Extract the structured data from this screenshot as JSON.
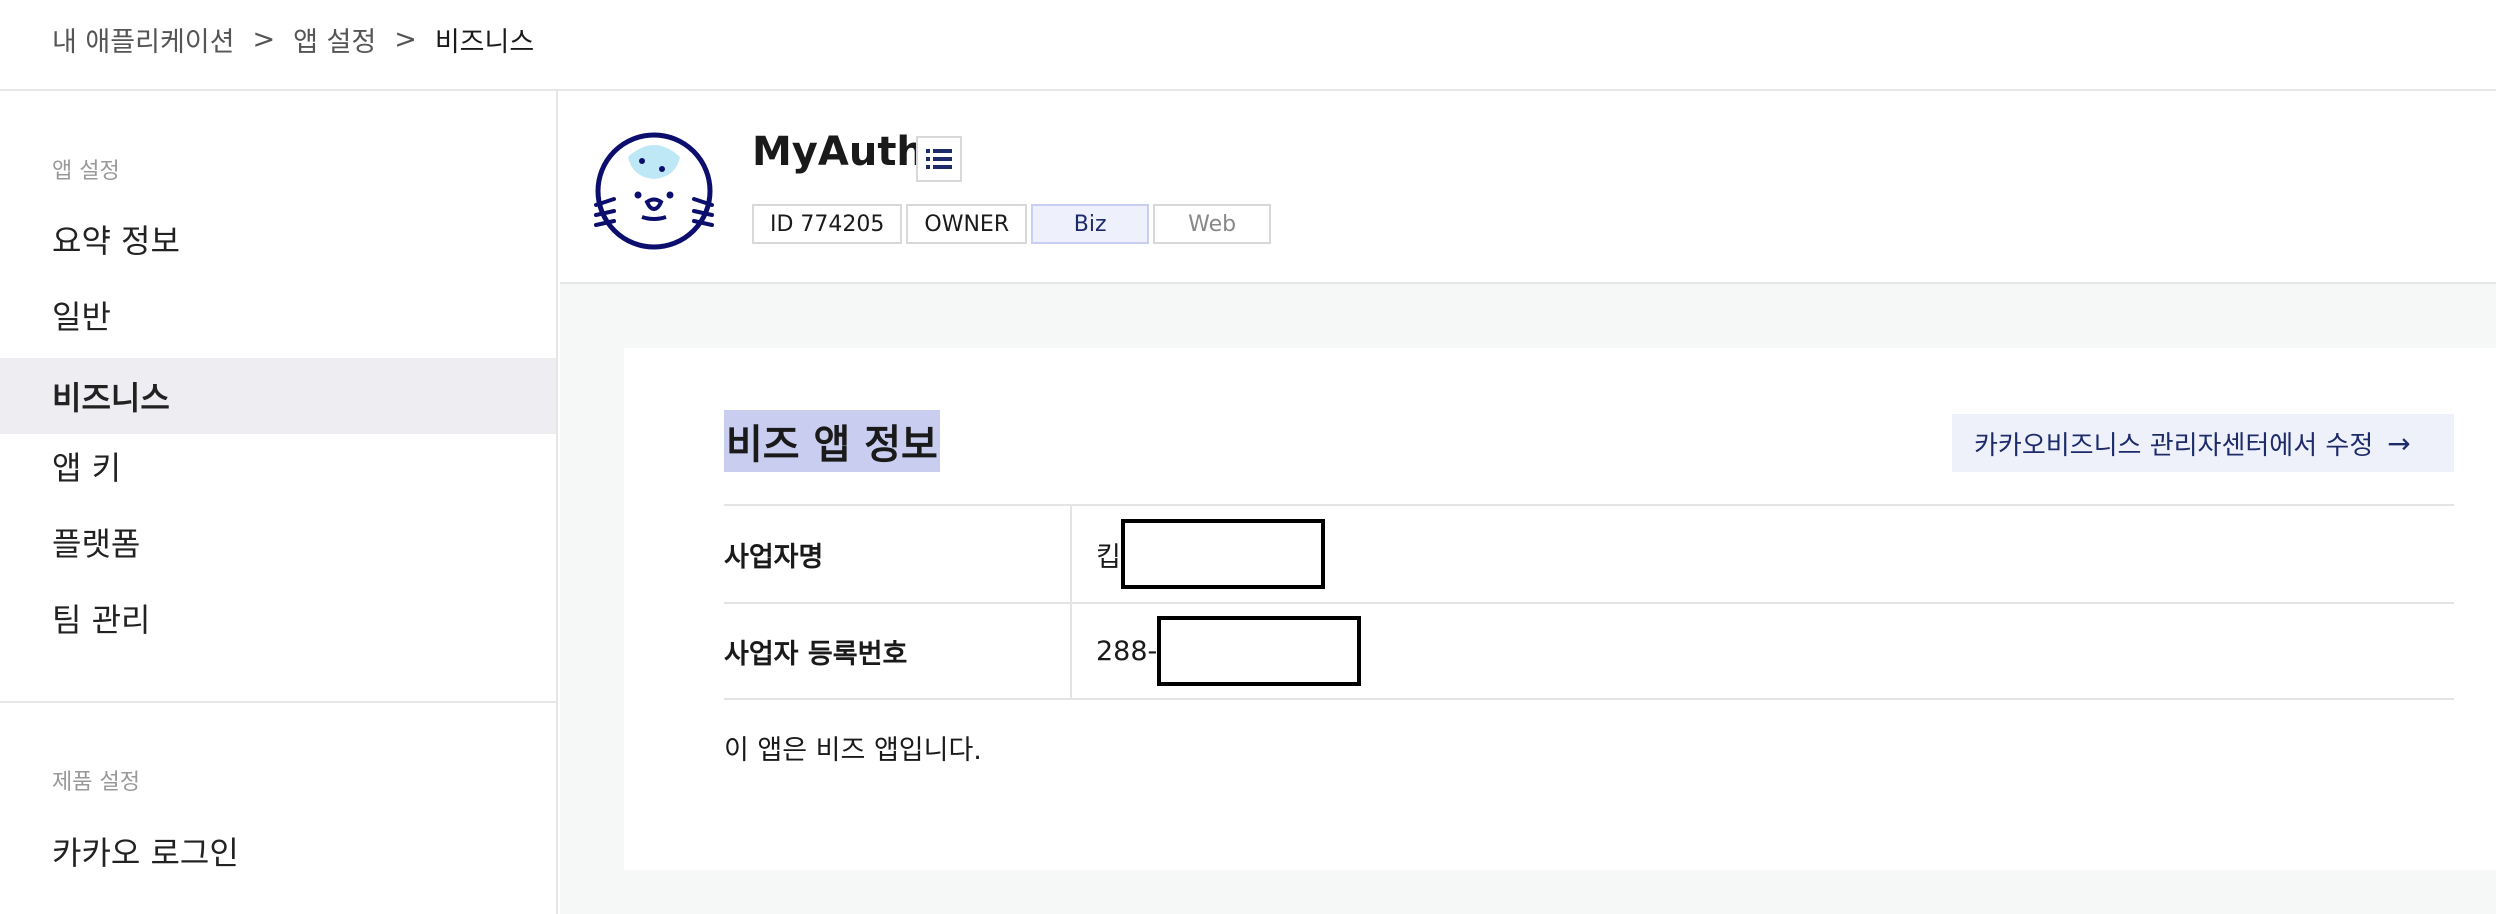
{
  "breadcrumb": {
    "items": [
      "내 애플리케이션",
      "앱 설정",
      "비즈니스"
    ],
    "separator": ">"
  },
  "sidebar": {
    "group1_label": "앱 설정",
    "items": [
      "요약 정보",
      "일반",
      "비즈니스",
      "앱 키",
      "플랫폼",
      "팀 관리"
    ],
    "active_item": "비즈니스",
    "group2_label": "제품 설정",
    "group2_items": [
      "카카오 로그인"
    ]
  },
  "app": {
    "name": "MyAuth",
    "tags": [
      "ID 774205",
      "OWNER",
      "Biz",
      "Web"
    ],
    "avatar_icon": "seal-mascot-icon",
    "list_icon": "list-icon"
  },
  "section": {
    "title": "비즈 앱 정보",
    "edit_link_label": "카카오비즈니스 관리자센터에서 수정",
    "edit_link_arrow": "→",
    "rows": [
      {
        "label": "사업자명",
        "value_prefix": "킵"
      },
      {
        "label": "사업자 등록번호",
        "value_prefix": "288-"
      }
    ],
    "note": "이 앱은 비즈 앱입니다."
  },
  "colors": {
    "accent": "#1d2b6b",
    "active_bg": "#eeeef2",
    "highlight": "#c9cdf0",
    "content_bg": "#f6f7f7"
  }
}
